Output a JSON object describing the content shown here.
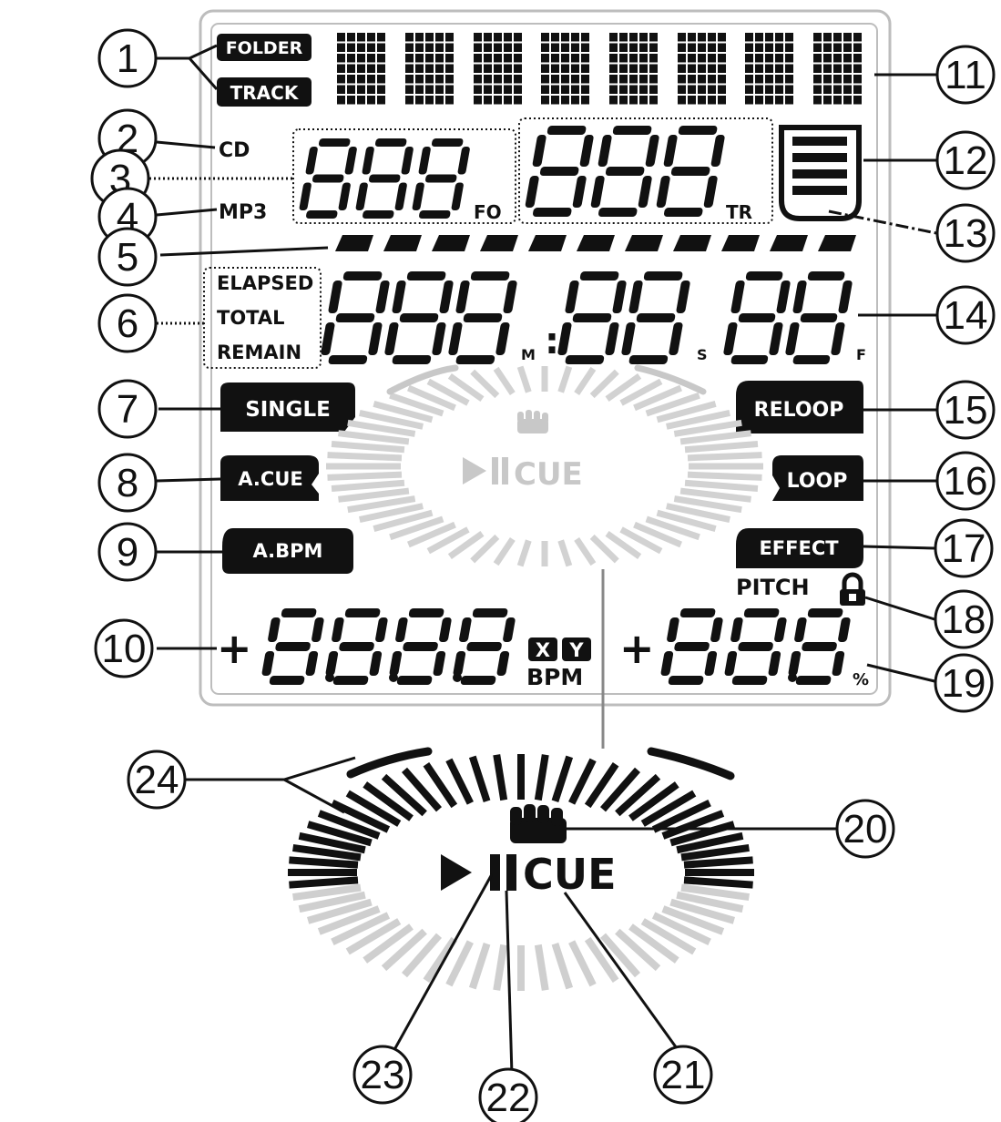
{
  "labels": {
    "folder": "FOLDER",
    "track": "TRACK",
    "cd": "CD",
    "mp3": "MP3",
    "fo": "FO",
    "tr": "TR",
    "elapsed": "ELAPSED",
    "total": "TOTAL",
    "remain": "REMAIN",
    "m": "M",
    "s": "S",
    "f": "F",
    "single": "SINGLE",
    "a_cue": "A.CUE",
    "a_bpm": "A.BPM",
    "reloop": "RELOOP",
    "loop": "LOOP",
    "effect": "EFFECT",
    "pitch": "PITCH",
    "x": "X",
    "y": "Y",
    "bpm": "BPM",
    "percent": "%",
    "cue_small": "CUE",
    "cue_large": "CUE",
    "colon": ":"
  },
  "callouts": [
    "1",
    "2",
    "3",
    "4",
    "5",
    "6",
    "7",
    "8",
    "9",
    "10",
    "11",
    "12",
    "13",
    "14",
    "15",
    "16",
    "17",
    "18",
    "19",
    "20",
    "21",
    "22",
    "23",
    "24"
  ],
  "colors": {
    "ink": "#111111",
    "frame": "#b8b8b8",
    "ring_gray": "#c8c8c8",
    "jog_gray": "#d9d9d9"
  }
}
